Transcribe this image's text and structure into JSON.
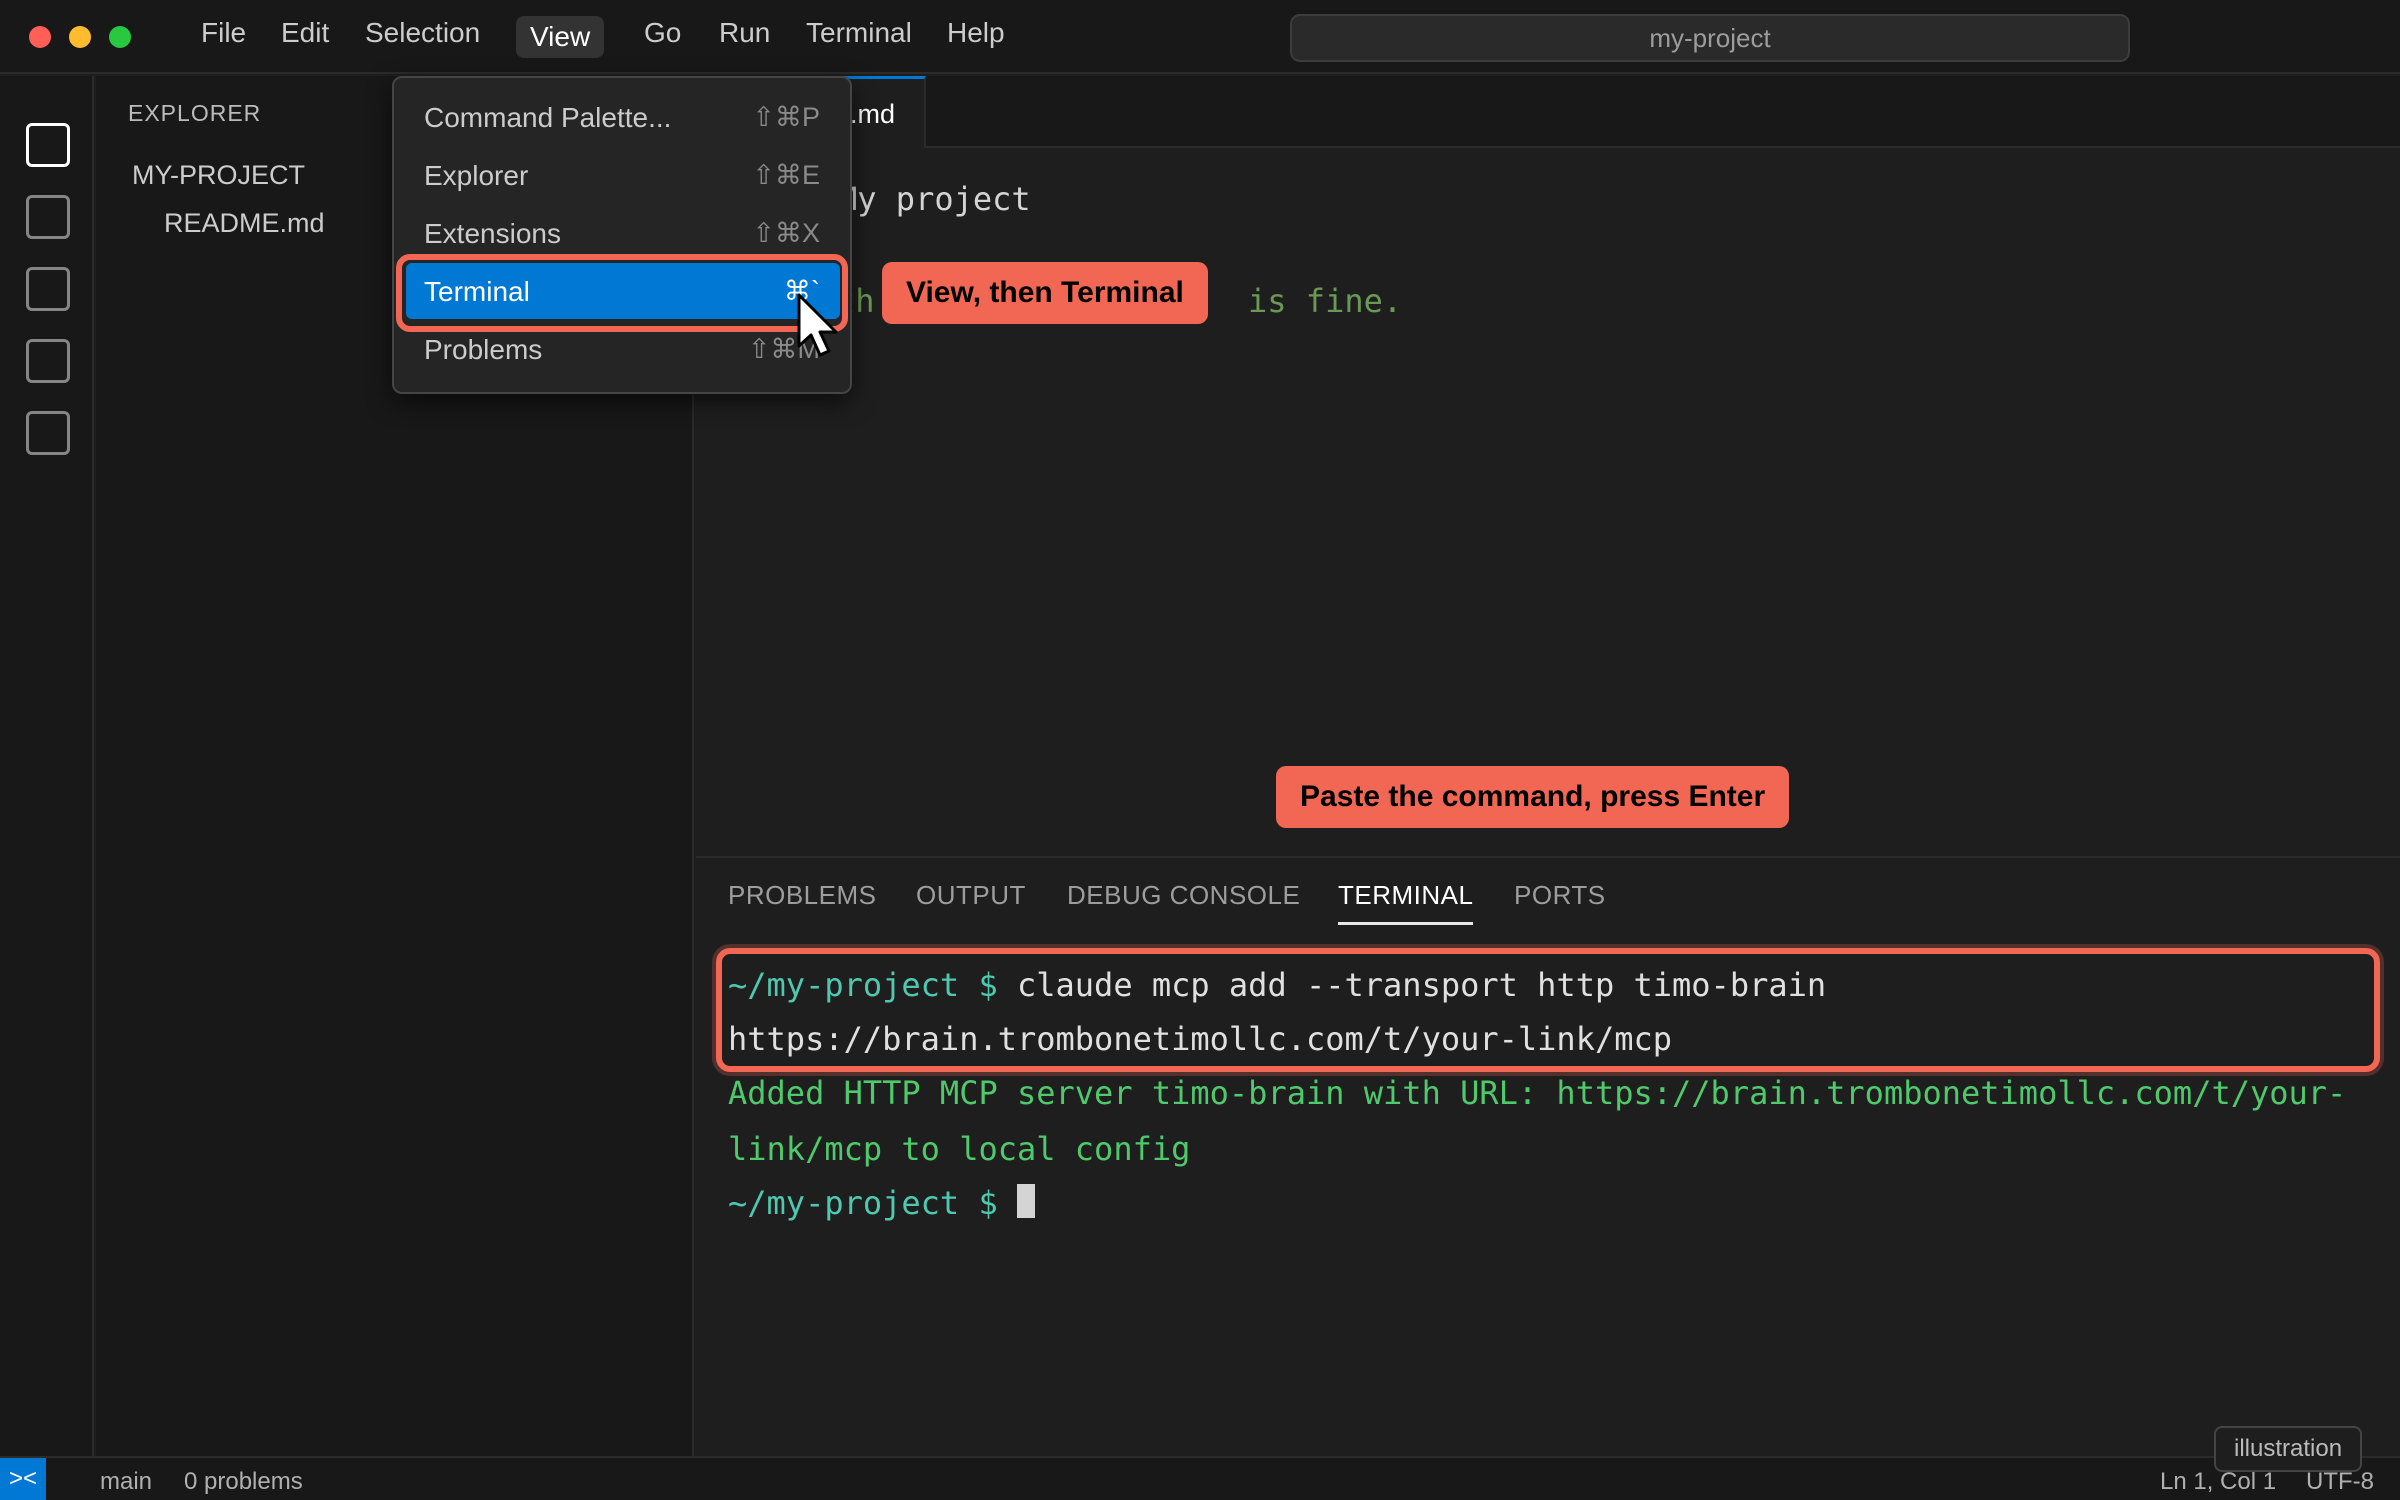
{
  "window": {
    "title": "my-project"
  },
  "menubar": {
    "items": [
      "File",
      "Edit",
      "Selection",
      "View",
      "Go",
      "Run",
      "Terminal",
      "Help"
    ],
    "active": "View"
  },
  "view_menu": {
    "items": [
      {
        "label": "Command Palette...",
        "shortcut": "⇧⌘P"
      },
      {
        "label": "Explorer",
        "shortcut": "⇧⌘E"
      },
      {
        "label": "Extensions",
        "shortcut": "⇧⌘X"
      },
      {
        "label": "Terminal",
        "shortcut": "⌘`"
      },
      {
        "label": "Problems",
        "shortcut": "⇧⌘M"
      }
    ],
    "selected": "Terminal"
  },
  "sidebar": {
    "heading": "EXPLORER",
    "folder": "MY-PROJECT",
    "files": [
      "README.md"
    ]
  },
  "editor": {
    "tab_label": "README.md",
    "tab_visible_label": ".md",
    "lines": [
      "# My project",
      "Anything is fine."
    ],
    "visible_lines": [
      "My project",
      "is fine."
    ],
    "partial_fragment": "th"
  },
  "panel": {
    "tabs": [
      "PROBLEMS",
      "OUTPUT",
      "DEBUG CONSOLE",
      "TERMINAL",
      "PORTS"
    ],
    "active_tab": "TERMINAL",
    "terminal": {
      "prompt": "~/my-project $",
      "command_line1": " claude mcp add --transport http timo-brain",
      "command_line2": "https://brain.trombonetimollc.com/t/your-link/mcp",
      "output_line1": "Added HTTP MCP server timo-brain with URL: https://brain.trombonetimollc.com/t/your-",
      "output_line2": "link/mcp to local config"
    }
  },
  "callouts": {
    "view_terminal": "View, then Terminal",
    "paste": "Paste the command, press Enter"
  },
  "statusbar": {
    "remote": "><",
    "branch": "main",
    "problems": "0 problems",
    "position": "Ln 1, Col 1",
    "encoding": "UTF-8"
  },
  "badge": "illustration",
  "colors": {
    "accent": "#0078d4",
    "callout": "#f26754",
    "prompt": "#4ec9b0",
    "success": "#4ec96b"
  }
}
